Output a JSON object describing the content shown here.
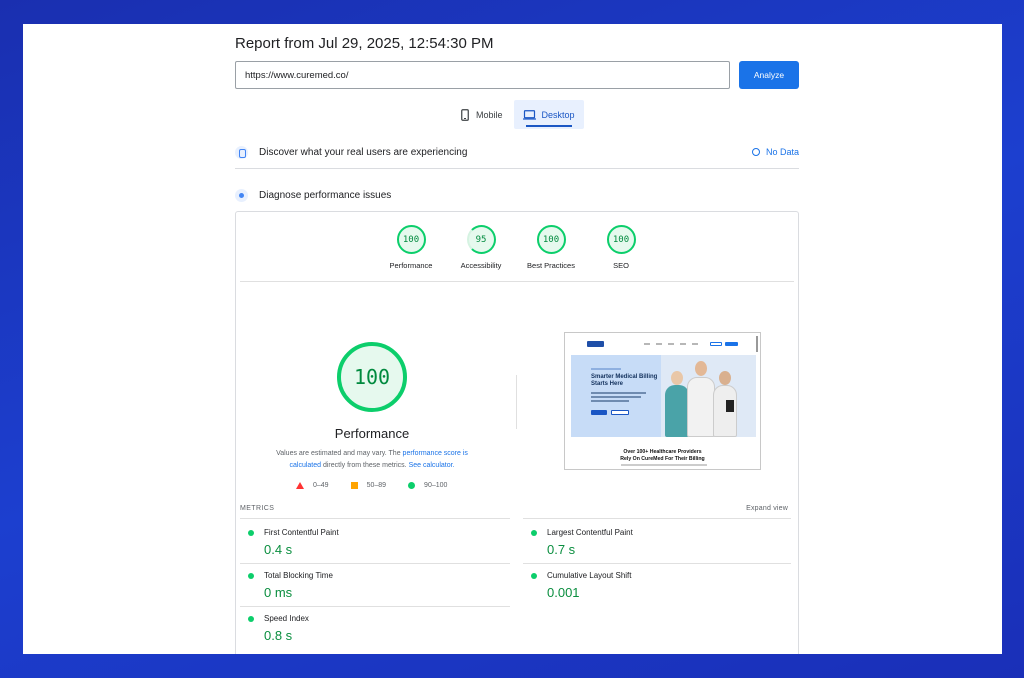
{
  "report": {
    "title": "Report from Jul 29, 2025, 12:54:30 PM"
  },
  "url_bar": {
    "value": "https://www.curemed.co/",
    "analyze_label": "Analyze"
  },
  "tabs": {
    "mobile": "Mobile",
    "desktop": "Desktop",
    "active": "Desktop"
  },
  "sections": {
    "discover": "Discover what your real users are experiencing",
    "no_data": "No Data",
    "diagnose": "Diagnose performance issues"
  },
  "gauges": [
    {
      "score": "100",
      "label": "Performance"
    },
    {
      "score": "95",
      "label": "Accessibility"
    },
    {
      "score": "100",
      "label": "Best Practices"
    },
    {
      "score": "100",
      "label": "SEO"
    }
  ],
  "performance": {
    "score": "100",
    "title": "Performance",
    "disclaimer_1": "Values are estimated and may vary. The",
    "disclaimer_link_1": "performance score is calculated",
    "disclaimer_2": "directly from these metrics.",
    "disclaimer_link_2": "See calculator."
  },
  "legend": {
    "bad": "0–49",
    "average": "50–89",
    "good": "90–100"
  },
  "screenshot": {
    "headline": "Smarter Medical Billing Starts Here",
    "footer_line_1": "Over 100+ Healthcare Providers",
    "footer_line_2": "Rely On CureMed For Their Billing"
  },
  "metrics": {
    "heading": "METRICS",
    "expand": "Expand view",
    "fcp": {
      "name": "First Contentful Paint",
      "value": "0.4 s"
    },
    "lcp": {
      "name": "Largest Contentful Paint",
      "value": "0.7 s"
    },
    "tbt": {
      "name": "Total Blocking Time",
      "value": "0 ms"
    },
    "cls": {
      "name": "Cumulative Layout Shift",
      "value": "0.001"
    },
    "si": {
      "name": "Speed Index",
      "value": "0.8 s"
    }
  },
  "colors": {
    "good": "#0cce6b",
    "average": "#ffa400",
    "bad": "#ff3333",
    "accent": "#1a73e8",
    "background": "#1c3fcf"
  }
}
